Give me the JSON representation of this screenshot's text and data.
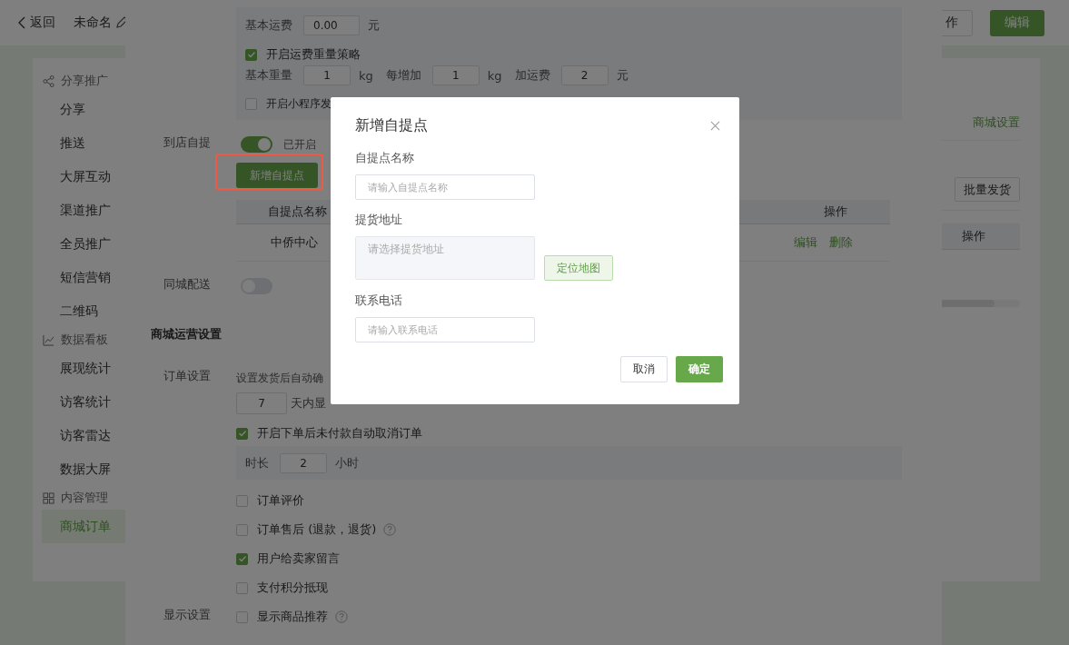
{
  "topbar": {
    "back": "返回",
    "title": "未命名",
    "action_button": "作",
    "edit_button": "编辑"
  },
  "sidebar": {
    "groups": [
      {
        "title": "分享推广",
        "kind": "share",
        "items": [
          {
            "label": "分享",
            "selected": false
          },
          {
            "label": "推送",
            "selected": false
          },
          {
            "label": "大屏互动",
            "selected": false
          },
          {
            "label": "渠道推广",
            "selected": false
          },
          {
            "label": "全员推广",
            "selected": false
          },
          {
            "label": "短信营销",
            "selected": false
          },
          {
            "label": "二维码",
            "selected": false
          }
        ]
      },
      {
        "title": "数据看板",
        "kind": "chart",
        "items": [
          {
            "label": "展现统计",
            "selected": false
          },
          {
            "label": "访客统计",
            "selected": false
          },
          {
            "label": "访客雷达",
            "selected": false
          },
          {
            "label": "数据大屏",
            "selected": false
          }
        ]
      },
      {
        "title": "内容管理",
        "kind": "grid",
        "items": [
          {
            "label": "商城订单",
            "selected": true
          }
        ]
      }
    ]
  },
  "main": {
    "settings_link": "商城设置",
    "batch_button": "批量发货",
    "table_header": "操作"
  },
  "drawer": {
    "shipping": {
      "base_fee_label": "基本运费",
      "base_fee": "0.00",
      "base_fee_unit": "元",
      "weight_policy": {
        "label": "开启运费重量策略",
        "checked": true
      },
      "weight_fields": [
        {
          "label": "基本重量",
          "value": "1",
          "unit": "kg"
        },
        {
          "label": "每增加",
          "value": "1",
          "unit": "kg"
        },
        {
          "label": "加运费",
          "value": "2",
          "unit": "元"
        }
      ],
      "miniprogram": {
        "label": "开启小程序发",
        "checked": false
      }
    },
    "pickup": {
      "label": "到店自提",
      "on": true,
      "status": "已开启",
      "add_button": "新增自提点",
      "columns": [
        "自提点名称",
        "操作"
      ],
      "rows": [
        {
          "name": "中侨中心",
          "actions": [
            "编辑",
            "删除"
          ]
        }
      ]
    },
    "local_delivery": {
      "label": "同城配送",
      "on": false
    },
    "section_title": "商城运营设置",
    "order": {
      "label": "订单设置",
      "auto_confirm_text": "设置发货后自动确",
      "days": "7",
      "days_text": "天内显",
      "auto_cancel": {
        "label": "开启下单后未付款自动取消订单",
        "checked": true
      },
      "duration_label": "时长",
      "duration": "2",
      "duration_unit": "小时",
      "options": [
        {
          "label": "订单评价",
          "checked": false,
          "help": false
        },
        {
          "label": "订单售后 (退款，退货)",
          "checked": false,
          "help": true
        },
        {
          "label": "用户给卖家留言",
          "checked": true,
          "help": false
        },
        {
          "label": "支付积分抵现",
          "checked": false,
          "help": false
        }
      ]
    },
    "display": {
      "label": "显示设置",
      "recommend": {
        "label": "显示商品推荐",
        "checked": false,
        "help": true
      }
    }
  },
  "dialog": {
    "title": "新增自提点",
    "fields": [
      {
        "label": "自提点名称",
        "placeholder": "请输入自提点名称",
        "kind": "input"
      },
      {
        "label": "提货地址",
        "placeholder": "请选择提货地址",
        "kind": "address",
        "button": "定位地图"
      },
      {
        "label": "联系电话",
        "placeholder": "请输入联系电话",
        "kind": "input"
      }
    ],
    "cancel": "取消",
    "confirm": "确定"
  }
}
